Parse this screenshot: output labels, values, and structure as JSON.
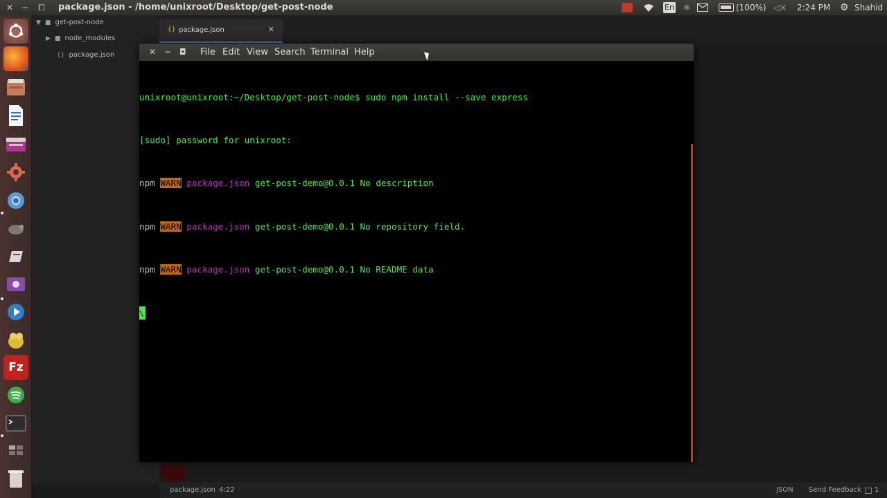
{
  "topbar": {
    "window_title": "package.json - /home/unixroot/Desktop/get-post-node",
    "close_glyph": "✕",
    "minimize_glyph": "−",
    "restore_glyph": "⧠",
    "tray": {
      "keyboard_layout": "En",
      "battery": "(100%)",
      "clock": "2:24 PM",
      "user": "Shahid"
    }
  },
  "launcher": {
    "items": [
      "ubuntu-dash",
      "firefox",
      "files",
      "libreoffice-writer",
      "software-center",
      "settings",
      "chromium",
      "mouse-app",
      "text-editor",
      "screen-recorder",
      "media-player",
      "pidgin",
      "filezilla",
      "spotify",
      "terminal",
      "workspace-switcher",
      "trash"
    ],
    "filezilla_letters": "Fz"
  },
  "tree": {
    "root": "get-post-node",
    "folder": "node_modules",
    "file": "package.json",
    "file_icon": "{}"
  },
  "tab": {
    "icon": "{}",
    "label": "package.json",
    "close": "✕"
  },
  "statusbar": {
    "file": "package.json",
    "cursor": "4:22",
    "grammar": "JSON",
    "feedback": "Send Feedback",
    "count": "1"
  },
  "terminal": {
    "menu": [
      "File",
      "Edit",
      "View",
      "Search",
      "Terminal",
      "Help"
    ],
    "controls": {
      "close": "✕",
      "minimize": "−",
      "maximize": "◘"
    },
    "prompt": "unixroot@unixroot:~/Desktop/get-post-node$ sudo npm install --save express",
    "sudo": "[sudo] password for unixroot:",
    "warn_lines": [
      {
        "npm": "npm",
        "level": "WARN",
        "src": "package.json",
        "msg": "get-post-demo@0.0.1 No description"
      },
      {
        "npm": "npm",
        "level": "WARN",
        "src": "package.json",
        "msg": "get-post-demo@0.0.1 No repository field."
      },
      {
        "npm": "npm",
        "level": "WARN",
        "src": "package.json",
        "msg": "get-post-demo@0.0.1 No README data"
      }
    ],
    "cursor_char": "\\"
  }
}
